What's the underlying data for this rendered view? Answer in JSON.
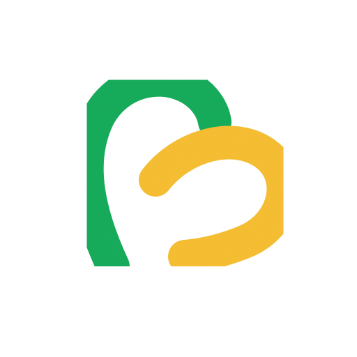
{
  "logo": {
    "icon": "abstract-heart-logo-icon",
    "colors": {
      "background": "#ffffff",
      "green_stroke": "#16AD5B",
      "yellow_stroke": "#F7BF33"
    }
  }
}
